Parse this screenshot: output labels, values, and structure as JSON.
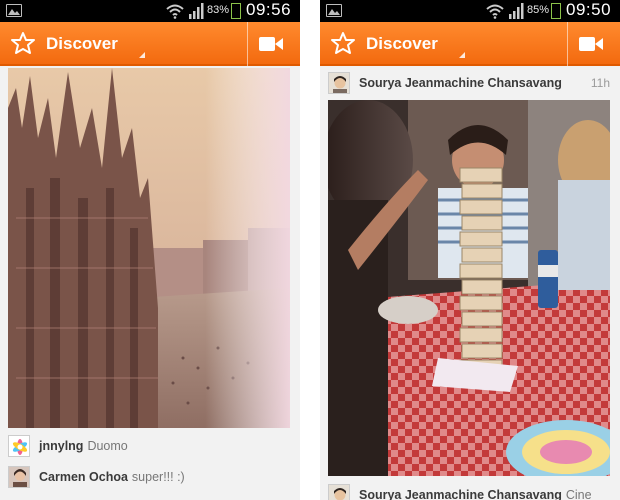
{
  "colors": {
    "accent": "#f47a1f",
    "statusbar": "#000000"
  },
  "left_screen": {
    "status": {
      "battery": "83%",
      "time": "09:56"
    },
    "actionbar": {
      "title": "Discover",
      "logo": "flower-logo-icon",
      "action": "video-camera-icon"
    },
    "photo": {
      "subject": "cathedral"
    },
    "comments": [
      {
        "user": "jnnylng",
        "text": "Duomo"
      },
      {
        "user": "Carmen Ochoa",
        "text": "super!!! :)"
      }
    ]
  },
  "right_screen": {
    "status": {
      "battery": "85%",
      "time": "09:50"
    },
    "actionbar": {
      "title": "Discover",
      "logo": "flower-logo-icon",
      "action": "video-camera-icon"
    },
    "post_header": {
      "user": "Sourya Jeanmachine Chansavang",
      "time": "11h"
    },
    "photo": {
      "subject": "jenga-tower"
    },
    "bottom_post": {
      "user": "Sourya Jeanmachine Chansavang",
      "text": "Cine"
    }
  }
}
